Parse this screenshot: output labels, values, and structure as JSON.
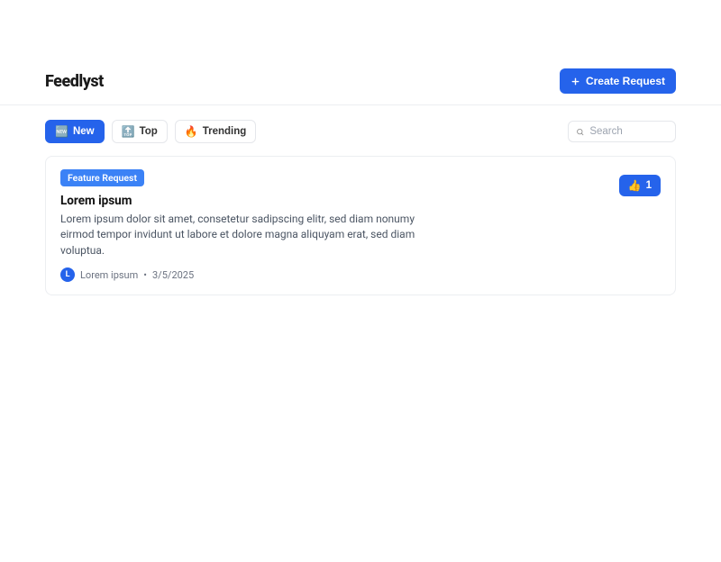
{
  "header": {
    "brand": "Feedlyst",
    "create_label": "Create Request"
  },
  "tabs": {
    "new": {
      "icon": "🆕",
      "label": "New"
    },
    "top": {
      "icon": "🔝",
      "label": "Top"
    },
    "trending": {
      "icon": "🔥",
      "label": "Trending"
    }
  },
  "search": {
    "placeholder": "Search"
  },
  "post": {
    "badge": "Feature Request",
    "title": "Lorem ipsum",
    "description": "Lorem ipsum dolor sit amet, consetetur sadipscing elitr, sed diam nonumy eirmod tempor invidunt ut labore et dolore magna aliquyam erat, sed diam voluptua.",
    "author_initial": "L",
    "author_name": "Lorem ipsum",
    "separator": "•",
    "date": "3/5/2025",
    "upvote_icon": "👍",
    "upvote_count": "1"
  }
}
